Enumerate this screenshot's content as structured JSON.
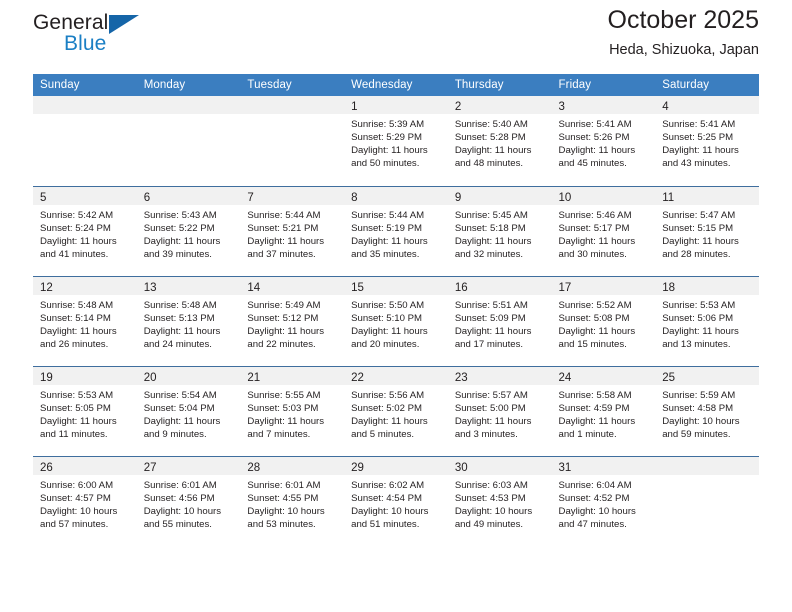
{
  "brand": {
    "word_one": "General",
    "word_two": "Blue",
    "triangle_icon": "blue-triangle-logo-icon",
    "accent_dark": "#1565a8",
    "accent_light": "#1b7fc4"
  },
  "header": {
    "title": "October 2025",
    "subtitle": "Heda, Shizuoka, Japan"
  },
  "colors": {
    "header_row_bg": "#3b7ec0",
    "row_divider": "#3f6e9e",
    "daynum_strip_bg": "#f1f1f1",
    "text": "#231f20"
  },
  "weekday_headers": [
    "Sunday",
    "Monday",
    "Tuesday",
    "Wednesday",
    "Thursday",
    "Friday",
    "Saturday"
  ],
  "labels": {
    "sunrise_prefix": "Sunrise:",
    "sunset_prefix": "Sunset:",
    "daylight_prefix": "Daylight:"
  },
  "weeks": [
    [
      {
        "day": "",
        "empty": true
      },
      {
        "day": "",
        "empty": true
      },
      {
        "day": "",
        "empty": true
      },
      {
        "day": "1",
        "sunrise": "Sunrise: 5:39 AM",
        "sunset": "Sunset: 5:29 PM",
        "daylight_1": "Daylight: 11 hours",
        "daylight_2": "and 50 minutes."
      },
      {
        "day": "2",
        "sunrise": "Sunrise: 5:40 AM",
        "sunset": "Sunset: 5:28 PM",
        "daylight_1": "Daylight: 11 hours",
        "daylight_2": "and 48 minutes."
      },
      {
        "day": "3",
        "sunrise": "Sunrise: 5:41 AM",
        "sunset": "Sunset: 5:26 PM",
        "daylight_1": "Daylight: 11 hours",
        "daylight_2": "and 45 minutes."
      },
      {
        "day": "4",
        "sunrise": "Sunrise: 5:41 AM",
        "sunset": "Sunset: 5:25 PM",
        "daylight_1": "Daylight: 11 hours",
        "daylight_2": "and 43 minutes."
      }
    ],
    [
      {
        "day": "5",
        "sunrise": "Sunrise: 5:42 AM",
        "sunset": "Sunset: 5:24 PM",
        "daylight_1": "Daylight: 11 hours",
        "daylight_2": "and 41 minutes."
      },
      {
        "day": "6",
        "sunrise": "Sunrise: 5:43 AM",
        "sunset": "Sunset: 5:22 PM",
        "daylight_1": "Daylight: 11 hours",
        "daylight_2": "and 39 minutes."
      },
      {
        "day": "7",
        "sunrise": "Sunrise: 5:44 AM",
        "sunset": "Sunset: 5:21 PM",
        "daylight_1": "Daylight: 11 hours",
        "daylight_2": "and 37 minutes."
      },
      {
        "day": "8",
        "sunrise": "Sunrise: 5:44 AM",
        "sunset": "Sunset: 5:19 PM",
        "daylight_1": "Daylight: 11 hours",
        "daylight_2": "and 35 minutes."
      },
      {
        "day": "9",
        "sunrise": "Sunrise: 5:45 AM",
        "sunset": "Sunset: 5:18 PM",
        "daylight_1": "Daylight: 11 hours",
        "daylight_2": "and 32 minutes."
      },
      {
        "day": "10",
        "sunrise": "Sunrise: 5:46 AM",
        "sunset": "Sunset: 5:17 PM",
        "daylight_1": "Daylight: 11 hours",
        "daylight_2": "and 30 minutes."
      },
      {
        "day": "11",
        "sunrise": "Sunrise: 5:47 AM",
        "sunset": "Sunset: 5:15 PM",
        "daylight_1": "Daylight: 11 hours",
        "daylight_2": "and 28 minutes."
      }
    ],
    [
      {
        "day": "12",
        "sunrise": "Sunrise: 5:48 AM",
        "sunset": "Sunset: 5:14 PM",
        "daylight_1": "Daylight: 11 hours",
        "daylight_2": "and 26 minutes."
      },
      {
        "day": "13",
        "sunrise": "Sunrise: 5:48 AM",
        "sunset": "Sunset: 5:13 PM",
        "daylight_1": "Daylight: 11 hours",
        "daylight_2": "and 24 minutes."
      },
      {
        "day": "14",
        "sunrise": "Sunrise: 5:49 AM",
        "sunset": "Sunset: 5:12 PM",
        "daylight_1": "Daylight: 11 hours",
        "daylight_2": "and 22 minutes."
      },
      {
        "day": "15",
        "sunrise": "Sunrise: 5:50 AM",
        "sunset": "Sunset: 5:10 PM",
        "daylight_1": "Daylight: 11 hours",
        "daylight_2": "and 20 minutes."
      },
      {
        "day": "16",
        "sunrise": "Sunrise: 5:51 AM",
        "sunset": "Sunset: 5:09 PM",
        "daylight_1": "Daylight: 11 hours",
        "daylight_2": "and 17 minutes."
      },
      {
        "day": "17",
        "sunrise": "Sunrise: 5:52 AM",
        "sunset": "Sunset: 5:08 PM",
        "daylight_1": "Daylight: 11 hours",
        "daylight_2": "and 15 minutes."
      },
      {
        "day": "18",
        "sunrise": "Sunrise: 5:53 AM",
        "sunset": "Sunset: 5:06 PM",
        "daylight_1": "Daylight: 11 hours",
        "daylight_2": "and 13 minutes."
      }
    ],
    [
      {
        "day": "19",
        "sunrise": "Sunrise: 5:53 AM",
        "sunset": "Sunset: 5:05 PM",
        "daylight_1": "Daylight: 11 hours",
        "daylight_2": "and 11 minutes."
      },
      {
        "day": "20",
        "sunrise": "Sunrise: 5:54 AM",
        "sunset": "Sunset: 5:04 PM",
        "daylight_1": "Daylight: 11 hours",
        "daylight_2": "and 9 minutes."
      },
      {
        "day": "21",
        "sunrise": "Sunrise: 5:55 AM",
        "sunset": "Sunset: 5:03 PM",
        "daylight_1": "Daylight: 11 hours",
        "daylight_2": "and 7 minutes."
      },
      {
        "day": "22",
        "sunrise": "Sunrise: 5:56 AM",
        "sunset": "Sunset: 5:02 PM",
        "daylight_1": "Daylight: 11 hours",
        "daylight_2": "and 5 minutes."
      },
      {
        "day": "23",
        "sunrise": "Sunrise: 5:57 AM",
        "sunset": "Sunset: 5:00 PM",
        "daylight_1": "Daylight: 11 hours",
        "daylight_2": "and 3 minutes."
      },
      {
        "day": "24",
        "sunrise": "Sunrise: 5:58 AM",
        "sunset": "Sunset: 4:59 PM",
        "daylight_1": "Daylight: 11 hours",
        "daylight_2": "and 1 minute."
      },
      {
        "day": "25",
        "sunrise": "Sunrise: 5:59 AM",
        "sunset": "Sunset: 4:58 PM",
        "daylight_1": "Daylight: 10 hours",
        "daylight_2": "and 59 minutes."
      }
    ],
    [
      {
        "day": "26",
        "sunrise": "Sunrise: 6:00 AM",
        "sunset": "Sunset: 4:57 PM",
        "daylight_1": "Daylight: 10 hours",
        "daylight_2": "and 57 minutes."
      },
      {
        "day": "27",
        "sunrise": "Sunrise: 6:01 AM",
        "sunset": "Sunset: 4:56 PM",
        "daylight_1": "Daylight: 10 hours",
        "daylight_2": "and 55 minutes."
      },
      {
        "day": "28",
        "sunrise": "Sunrise: 6:01 AM",
        "sunset": "Sunset: 4:55 PM",
        "daylight_1": "Daylight: 10 hours",
        "daylight_2": "and 53 minutes."
      },
      {
        "day": "29",
        "sunrise": "Sunrise: 6:02 AM",
        "sunset": "Sunset: 4:54 PM",
        "daylight_1": "Daylight: 10 hours",
        "daylight_2": "and 51 minutes."
      },
      {
        "day": "30",
        "sunrise": "Sunrise: 6:03 AM",
        "sunset": "Sunset: 4:53 PM",
        "daylight_1": "Daylight: 10 hours",
        "daylight_2": "and 49 minutes."
      },
      {
        "day": "31",
        "sunrise": "Sunrise: 6:04 AM",
        "sunset": "Sunset: 4:52 PM",
        "daylight_1": "Daylight: 10 hours",
        "daylight_2": "and 47 minutes."
      },
      {
        "day": "",
        "empty": true
      }
    ]
  ]
}
